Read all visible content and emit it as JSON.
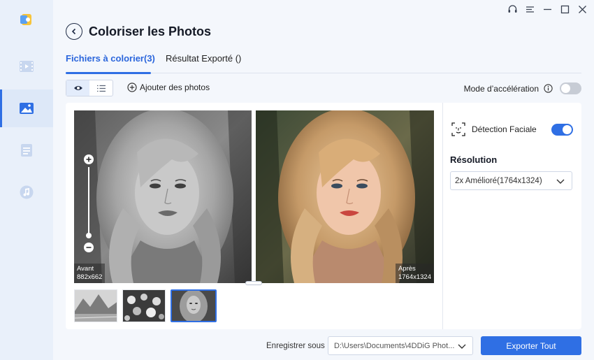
{
  "header": {
    "title": "Coloriser les Photos"
  },
  "tabs": [
    {
      "label": "Fichiers à colorier(3)",
      "active": true
    },
    {
      "label": "Résultat Exporté ()",
      "active": false
    }
  ],
  "toolbar": {
    "add_photos_label": "Ajouter des photos",
    "acceleration_label": "Mode d’accélération",
    "acceleration_enabled": false
  },
  "preview": {
    "before": {
      "caption": "Avant",
      "dimensions": "882x662"
    },
    "after": {
      "caption": "Après",
      "dimensions": "1764x1324"
    }
  },
  "thumbnails": [
    {
      "subject": "mountain lake",
      "selected": false
    },
    {
      "subject": "flowers",
      "selected": false
    },
    {
      "subject": "portrait",
      "selected": true
    }
  ],
  "settings": {
    "face_detection_label": "Détection Faciale",
    "face_detection_enabled": true,
    "resolution_title": "Résolution",
    "resolution_value": "2x Amélioré(1764x1324)"
  },
  "footer": {
    "save_label": "Enregistrer sous",
    "path_value": "D:\\Users\\Documents\\4DDiG Phot...",
    "export_label": "Exporter Tout"
  },
  "sidebar": {
    "items": [
      {
        "icon": "video-icon",
        "active": false
      },
      {
        "icon": "photo-icon",
        "active": true
      },
      {
        "icon": "document-icon",
        "active": false
      },
      {
        "icon": "music-icon",
        "active": false
      }
    ]
  },
  "colors": {
    "accent": "#2f6fe4",
    "sidebar_bg": "#e9f0fa",
    "panel_bg": "#f4f7fc"
  }
}
